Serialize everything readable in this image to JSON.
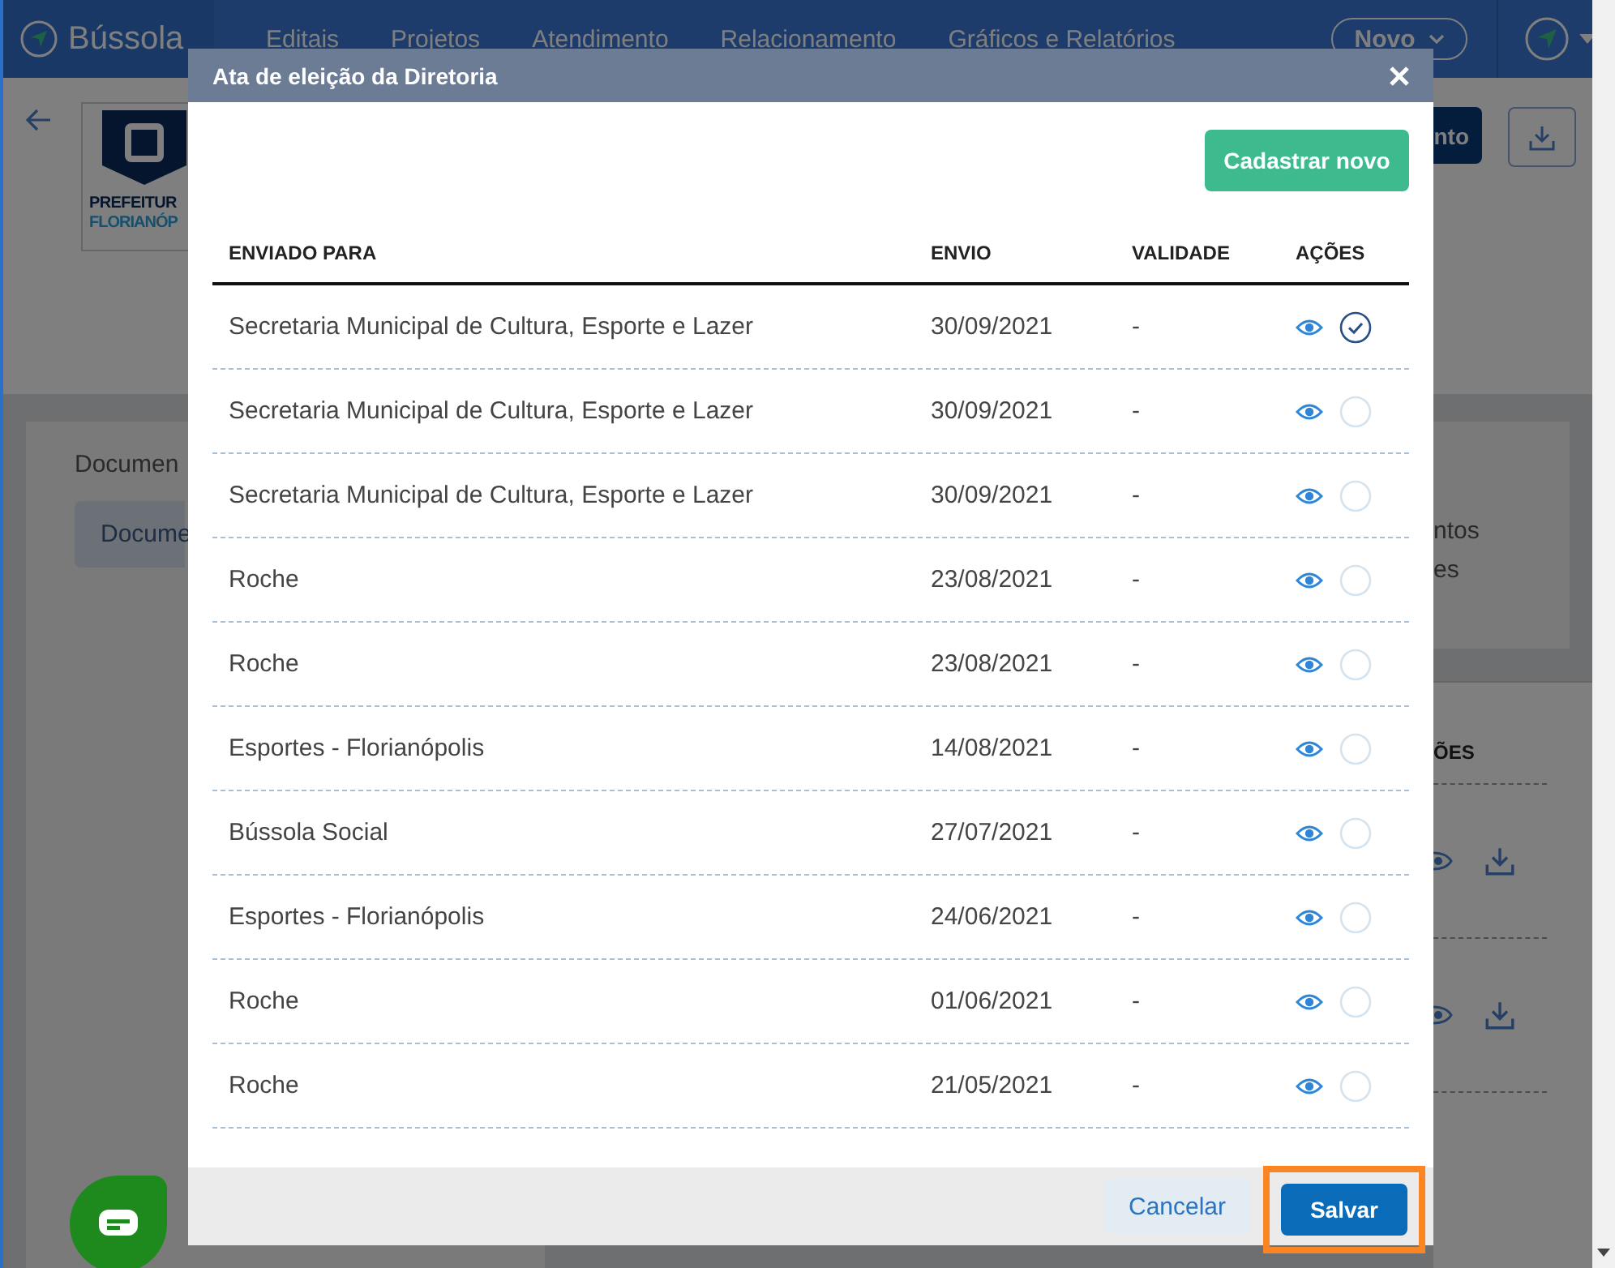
{
  "navbar": {
    "logo": "Bússola",
    "items": [
      "Editais",
      "Projetos",
      "Atendimento",
      "Relacionamento",
      "Gráficos e Relatórios"
    ],
    "new_button": "Novo"
  },
  "background": {
    "logo_lines": [
      "PREFEITUR",
      "FLORIANÓP"
    ],
    "action_button": "nto",
    "section_title": "Documen",
    "tab": "Docume",
    "side_texts": [
      "ntos",
      "es"
    ],
    "column_header": "ÕES"
  },
  "modal": {
    "title": "Ata de eleição da Diretoria",
    "add_button": "Cadastrar novo",
    "columns": [
      "ENVIADO PARA",
      "ENVIO",
      "VALIDADE",
      "AÇÕES"
    ],
    "rows": [
      {
        "recipient": "Secretaria Municipal de Cultura, Esporte e Lazer",
        "sent": "30/09/2021",
        "validity": "-",
        "selected": true
      },
      {
        "recipient": "Secretaria Municipal de Cultura, Esporte e Lazer",
        "sent": "30/09/2021",
        "validity": "-",
        "selected": false
      },
      {
        "recipient": "Secretaria Municipal de Cultura, Esporte e Lazer",
        "sent": "30/09/2021",
        "validity": "-",
        "selected": false
      },
      {
        "recipient": "Roche",
        "sent": "23/08/2021",
        "validity": "-",
        "selected": false
      },
      {
        "recipient": "Roche",
        "sent": "23/08/2021",
        "validity": "-",
        "selected": false
      },
      {
        "recipient": "Esportes - Florianópolis",
        "sent": "14/08/2021",
        "validity": "-",
        "selected": false
      },
      {
        "recipient": "Bússola Social",
        "sent": "27/07/2021",
        "validity": "-",
        "selected": false
      },
      {
        "recipient": "Esportes - Florianópolis",
        "sent": "24/06/2021",
        "validity": "-",
        "selected": false
      },
      {
        "recipient": "Roche",
        "sent": "01/06/2021",
        "validity": "-",
        "selected": false
      },
      {
        "recipient": "Roche",
        "sent": "21/05/2021",
        "validity": "-",
        "selected": false
      }
    ],
    "cancel_button": "Cancelar",
    "save_button": "Salvar"
  }
}
